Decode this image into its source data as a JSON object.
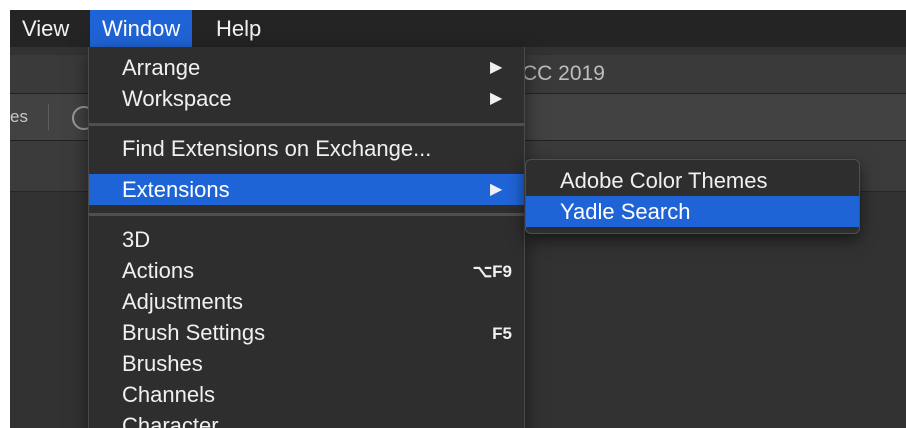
{
  "menubar": {
    "items": [
      {
        "label": "View"
      },
      {
        "label": "Window"
      },
      {
        "label": "Help"
      }
    ],
    "active": "Window"
  },
  "window": {
    "title_fragment": "CC 2019",
    "options_label_fragment": "es"
  },
  "window_menu": {
    "items": [
      {
        "label": "Arrange",
        "submenu": true
      },
      {
        "label": "Workspace",
        "submenu": true
      },
      {
        "label": "Find Extensions on Exchange..."
      },
      {
        "label": "Extensions",
        "submenu": true,
        "highlighted": true
      },
      {
        "label": "3D"
      },
      {
        "label": "Actions",
        "shortcut": "⌥F9"
      },
      {
        "label": "Adjustments"
      },
      {
        "label": "Brush Settings",
        "shortcut": "F5"
      },
      {
        "label": "Brushes"
      },
      {
        "label": "Channels"
      },
      {
        "label": "Character"
      }
    ],
    "arrow_glyph": "▶"
  },
  "extensions_submenu": {
    "items": [
      {
        "label": "Adobe Color Themes"
      },
      {
        "label": "Yadle Search",
        "highlighted": true
      }
    ]
  },
  "colors": {
    "highlight": "#1f64d6",
    "menu_bg": "#2e2e2e",
    "menubar_bg": "#242424"
  }
}
